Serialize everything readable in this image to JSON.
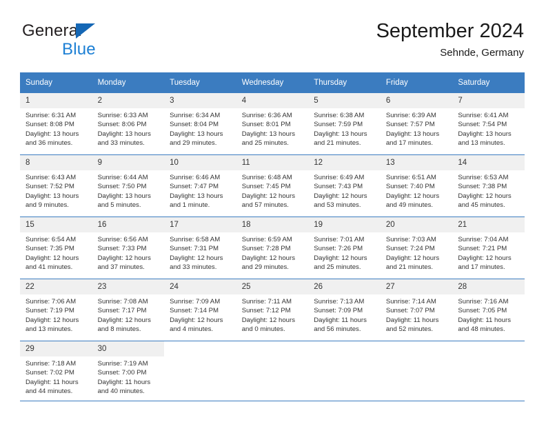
{
  "brand": {
    "name_top": "General",
    "name_bottom": "Blue",
    "triangle_color": "#1567b5",
    "blue_text_color": "#1c7fd4"
  },
  "header": {
    "title": "September 2024",
    "subtitle": "Sehnde, Germany"
  },
  "theme": {
    "header_blue": "#3b7cc0",
    "daynum_gray": "#f0f0f0",
    "text_color": "#333333"
  },
  "calendar": {
    "weekday_headers": [
      "Sunday",
      "Monday",
      "Tuesday",
      "Wednesday",
      "Thursday",
      "Friday",
      "Saturday"
    ],
    "labels": {
      "sunrise": "Sunrise:",
      "sunset": "Sunset:",
      "daylight": "Daylight:"
    },
    "weeks": [
      [
        {
          "day": "1",
          "sunrise": "Sunrise: 6:31 AM",
          "sunset": "Sunset: 8:08 PM",
          "daylight_line1": "Daylight: 13 hours",
          "daylight_line2": "and 36 minutes."
        },
        {
          "day": "2",
          "sunrise": "Sunrise: 6:33 AM",
          "sunset": "Sunset: 8:06 PM",
          "daylight_line1": "Daylight: 13 hours",
          "daylight_line2": "and 33 minutes."
        },
        {
          "day": "3",
          "sunrise": "Sunrise: 6:34 AM",
          "sunset": "Sunset: 8:04 PM",
          "daylight_line1": "Daylight: 13 hours",
          "daylight_line2": "and 29 minutes."
        },
        {
          "day": "4",
          "sunrise": "Sunrise: 6:36 AM",
          "sunset": "Sunset: 8:01 PM",
          "daylight_line1": "Daylight: 13 hours",
          "daylight_line2": "and 25 minutes."
        },
        {
          "day": "5",
          "sunrise": "Sunrise: 6:38 AM",
          "sunset": "Sunset: 7:59 PM",
          "daylight_line1": "Daylight: 13 hours",
          "daylight_line2": "and 21 minutes."
        },
        {
          "day": "6",
          "sunrise": "Sunrise: 6:39 AM",
          "sunset": "Sunset: 7:57 PM",
          "daylight_line1": "Daylight: 13 hours",
          "daylight_line2": "and 17 minutes."
        },
        {
          "day": "7",
          "sunrise": "Sunrise: 6:41 AM",
          "sunset": "Sunset: 7:54 PM",
          "daylight_line1": "Daylight: 13 hours",
          "daylight_line2": "and 13 minutes."
        }
      ],
      [
        {
          "day": "8",
          "sunrise": "Sunrise: 6:43 AM",
          "sunset": "Sunset: 7:52 PM",
          "daylight_line1": "Daylight: 13 hours",
          "daylight_line2": "and 9 minutes."
        },
        {
          "day": "9",
          "sunrise": "Sunrise: 6:44 AM",
          "sunset": "Sunset: 7:50 PM",
          "daylight_line1": "Daylight: 13 hours",
          "daylight_line2": "and 5 minutes."
        },
        {
          "day": "10",
          "sunrise": "Sunrise: 6:46 AM",
          "sunset": "Sunset: 7:47 PM",
          "daylight_line1": "Daylight: 13 hours",
          "daylight_line2": "and 1 minute."
        },
        {
          "day": "11",
          "sunrise": "Sunrise: 6:48 AM",
          "sunset": "Sunset: 7:45 PM",
          "daylight_line1": "Daylight: 12 hours",
          "daylight_line2": "and 57 minutes."
        },
        {
          "day": "12",
          "sunrise": "Sunrise: 6:49 AM",
          "sunset": "Sunset: 7:43 PM",
          "daylight_line1": "Daylight: 12 hours",
          "daylight_line2": "and 53 minutes."
        },
        {
          "day": "13",
          "sunrise": "Sunrise: 6:51 AM",
          "sunset": "Sunset: 7:40 PM",
          "daylight_line1": "Daylight: 12 hours",
          "daylight_line2": "and 49 minutes."
        },
        {
          "day": "14",
          "sunrise": "Sunrise: 6:53 AM",
          "sunset": "Sunset: 7:38 PM",
          "daylight_line1": "Daylight: 12 hours",
          "daylight_line2": "and 45 minutes."
        }
      ],
      [
        {
          "day": "15",
          "sunrise": "Sunrise: 6:54 AM",
          "sunset": "Sunset: 7:35 PM",
          "daylight_line1": "Daylight: 12 hours",
          "daylight_line2": "and 41 minutes."
        },
        {
          "day": "16",
          "sunrise": "Sunrise: 6:56 AM",
          "sunset": "Sunset: 7:33 PM",
          "daylight_line1": "Daylight: 12 hours",
          "daylight_line2": "and 37 minutes."
        },
        {
          "day": "17",
          "sunrise": "Sunrise: 6:58 AM",
          "sunset": "Sunset: 7:31 PM",
          "daylight_line1": "Daylight: 12 hours",
          "daylight_line2": "and 33 minutes."
        },
        {
          "day": "18",
          "sunrise": "Sunrise: 6:59 AM",
          "sunset": "Sunset: 7:28 PM",
          "daylight_line1": "Daylight: 12 hours",
          "daylight_line2": "and 29 minutes."
        },
        {
          "day": "19",
          "sunrise": "Sunrise: 7:01 AM",
          "sunset": "Sunset: 7:26 PM",
          "daylight_line1": "Daylight: 12 hours",
          "daylight_line2": "and 25 minutes."
        },
        {
          "day": "20",
          "sunrise": "Sunrise: 7:03 AM",
          "sunset": "Sunset: 7:24 PM",
          "daylight_line1": "Daylight: 12 hours",
          "daylight_line2": "and 21 minutes."
        },
        {
          "day": "21",
          "sunrise": "Sunrise: 7:04 AM",
          "sunset": "Sunset: 7:21 PM",
          "daylight_line1": "Daylight: 12 hours",
          "daylight_line2": "and 17 minutes."
        }
      ],
      [
        {
          "day": "22",
          "sunrise": "Sunrise: 7:06 AM",
          "sunset": "Sunset: 7:19 PM",
          "daylight_line1": "Daylight: 12 hours",
          "daylight_line2": "and 13 minutes."
        },
        {
          "day": "23",
          "sunrise": "Sunrise: 7:08 AM",
          "sunset": "Sunset: 7:17 PM",
          "daylight_line1": "Daylight: 12 hours",
          "daylight_line2": "and 8 minutes."
        },
        {
          "day": "24",
          "sunrise": "Sunrise: 7:09 AM",
          "sunset": "Sunset: 7:14 PM",
          "daylight_line1": "Daylight: 12 hours",
          "daylight_line2": "and 4 minutes."
        },
        {
          "day": "25",
          "sunrise": "Sunrise: 7:11 AM",
          "sunset": "Sunset: 7:12 PM",
          "daylight_line1": "Daylight: 12 hours",
          "daylight_line2": "and 0 minutes."
        },
        {
          "day": "26",
          "sunrise": "Sunrise: 7:13 AM",
          "sunset": "Sunset: 7:09 PM",
          "daylight_line1": "Daylight: 11 hours",
          "daylight_line2": "and 56 minutes."
        },
        {
          "day": "27",
          "sunrise": "Sunrise: 7:14 AM",
          "sunset": "Sunset: 7:07 PM",
          "daylight_line1": "Daylight: 11 hours",
          "daylight_line2": "and 52 minutes."
        },
        {
          "day": "28",
          "sunrise": "Sunrise: 7:16 AM",
          "sunset": "Sunset: 7:05 PM",
          "daylight_line1": "Daylight: 11 hours",
          "daylight_line2": "and 48 minutes."
        }
      ],
      [
        {
          "day": "29",
          "sunrise": "Sunrise: 7:18 AM",
          "sunset": "Sunset: 7:02 PM",
          "daylight_line1": "Daylight: 11 hours",
          "daylight_line2": "and 44 minutes."
        },
        {
          "day": "30",
          "sunrise": "Sunrise: 7:19 AM",
          "sunset": "Sunset: 7:00 PM",
          "daylight_line1": "Daylight: 11 hours",
          "daylight_line2": "and 40 minutes."
        },
        {
          "day": "",
          "sunrise": "",
          "sunset": "",
          "daylight_line1": "",
          "daylight_line2": ""
        },
        {
          "day": "",
          "sunrise": "",
          "sunset": "",
          "daylight_line1": "",
          "daylight_line2": ""
        },
        {
          "day": "",
          "sunrise": "",
          "sunset": "",
          "daylight_line1": "",
          "daylight_line2": ""
        },
        {
          "day": "",
          "sunrise": "",
          "sunset": "",
          "daylight_line1": "",
          "daylight_line2": ""
        },
        {
          "day": "",
          "sunrise": "",
          "sunset": "",
          "daylight_line1": "",
          "daylight_line2": ""
        }
      ]
    ]
  }
}
